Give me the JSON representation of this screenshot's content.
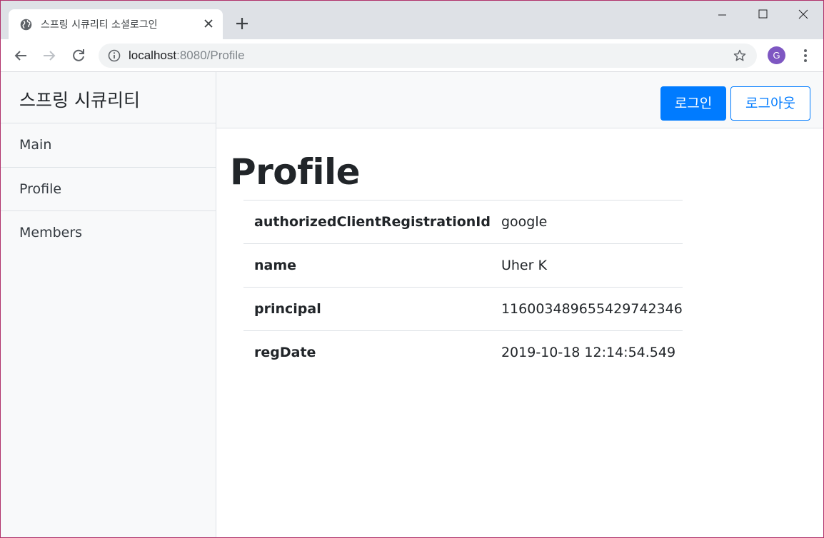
{
  "browser": {
    "tab_title": "스프링 시큐리티 소셜로그인",
    "url_host": "localhost",
    "url_rest": ":8080/Profile",
    "avatar_letter": "G",
    "avatar_color": "#7e57c2",
    "icons": [
      "globe-icon",
      "close-icon",
      "plus-icon",
      "minimize-icon",
      "maximize-icon",
      "window-close-icon",
      "back-arrow-icon",
      "forward-arrow-icon",
      "reload-icon",
      "info-icon",
      "star-icon",
      "more-vert-icon"
    ]
  },
  "sidebar": {
    "brand": "스프링 시큐리티",
    "items": [
      {
        "label": "Main"
      },
      {
        "label": "Profile"
      },
      {
        "label": "Members"
      }
    ]
  },
  "topnav": {
    "login_label": "로그인",
    "logout_label": "로그아웃",
    "accent": "#007bff"
  },
  "main": {
    "title": "Profile",
    "rows": [
      {
        "key": "authorizedClientRegistrationId",
        "value": "google"
      },
      {
        "key": "name",
        "value": "Uher K"
      },
      {
        "key": "principal",
        "value": "116003489655429742346"
      },
      {
        "key": "regDate",
        "value": "2019-10-18 12:14:54.549"
      }
    ]
  }
}
